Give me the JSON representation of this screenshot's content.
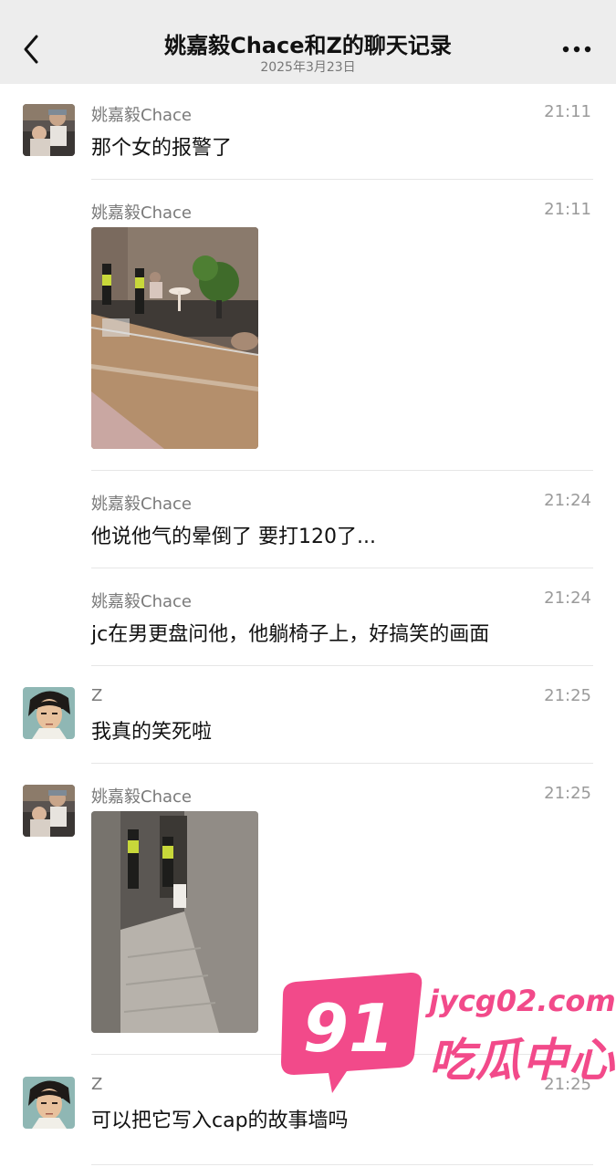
{
  "header": {
    "title": "姚嘉毅Chace和Z的聊天记录",
    "subtitle": "2025年3月23日",
    "back_icon": "chevron-left-icon",
    "more_icon": "more-dots-icon"
  },
  "messages": [
    {
      "sender": "姚嘉毅Chace",
      "time": "21:11",
      "text": "那个女的报警了"
    },
    {
      "sender": "姚嘉毅Chace",
      "time": "21:11",
      "image": "photo-lobby-police"
    },
    {
      "sender": "姚嘉毅Chace",
      "time": "21:24",
      "text": "他说他气的晕倒了 要打120了..."
    },
    {
      "sender": "姚嘉毅Chace",
      "time": "21:24",
      "text": "jc在男更盘问他，他躺椅子上，好搞笑的画面"
    },
    {
      "sender": "Z",
      "time": "21:25",
      "text": "我真的笑死啦"
    },
    {
      "sender": "姚嘉毅Chace",
      "time": "21:25",
      "image": "photo-stairway-police"
    },
    {
      "sender": "Z",
      "time": "21:25",
      "text": "可以把它写入cap的故事墙吗"
    }
  ],
  "watermark": {
    "number": "91",
    "domain": "jycg02.com",
    "name": "吃瓜中心",
    "color": "#f24a8a"
  }
}
